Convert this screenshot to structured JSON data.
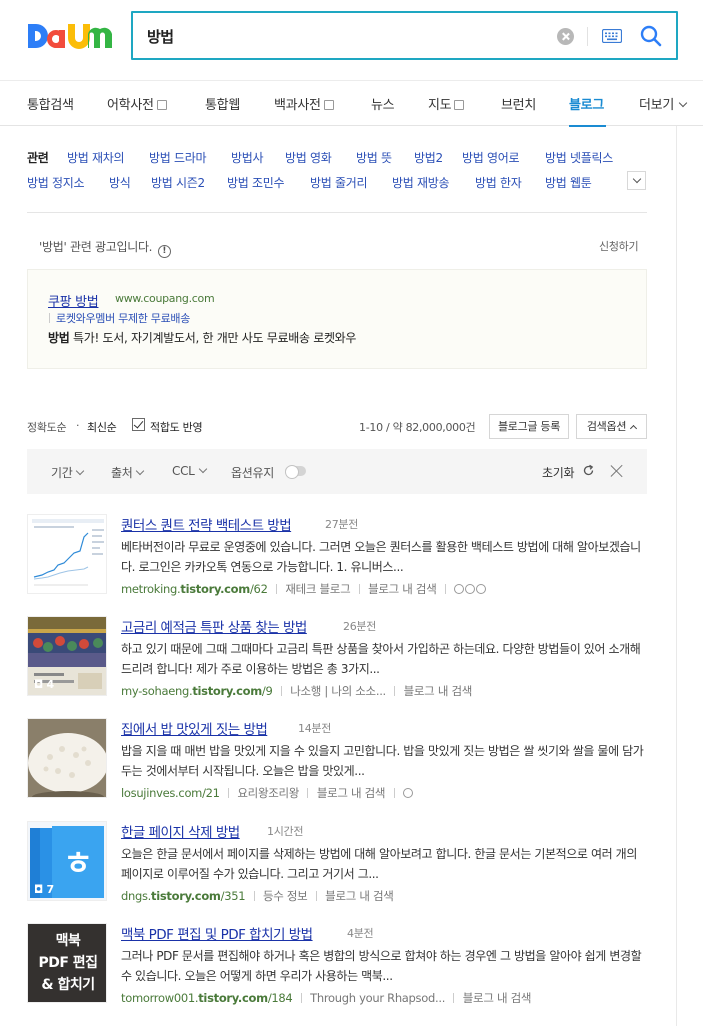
{
  "brand": {
    "logo_text": "Daum",
    "colors": {
      "d": "#2d7ef7",
      "a": "#f24c3d",
      "u": "#fbbd08",
      "m": "#34b544",
      "accent": "#1a8bd2",
      "link": "#1a32a8",
      "url": "#4a7a3a"
    }
  },
  "search": {
    "query": "방법",
    "clear_icon": "clear-icon",
    "keyboard_icon": "keyboard-icon",
    "search_icon": "search-icon"
  },
  "tabs": [
    {
      "label": "통합검색"
    },
    {
      "label": "어학사전"
    },
    {
      "label": "통합웹"
    },
    {
      "label": "백과사전"
    },
    {
      "label": "뉴스"
    },
    {
      "label": "지도"
    },
    {
      "label": "브런치"
    },
    {
      "label": "블로그",
      "active": true
    },
    {
      "label": "더보기"
    }
  ],
  "related": {
    "heading": "관련",
    "links": [
      "방법 재차의",
      "방법 드라마",
      "방법사",
      "방법 영화",
      "방법 뜻",
      "방법2",
      "방법 영어로",
      "방법 넷플릭스",
      "방법 정지소",
      "방식",
      "방법 시즌2",
      "방법 조민수",
      "방법 줄거리",
      "방법 재방송",
      "방법 한자",
      "방법 웹툰"
    ]
  },
  "ad": {
    "notice": "'방법' 관련 광고입니다.",
    "info_icon": "!",
    "apply": "신청하기",
    "title": "쿠팡 방법",
    "url": "www.coupang.com",
    "sub": "로켓와우멤버 무제한 무료배송",
    "desc_bold": "방법",
    "desc_rest": " 특가! 도서, 자기계발도서, 한 개만 사도 무료배송 로켓와우"
  },
  "sort": {
    "accuracy": "정확도순",
    "dot": "·",
    "latest": "최신순",
    "reflect": "적합도 반영",
    "count": "1-10 / 약 82,000,000건",
    "register": "블로그글 등록",
    "options": "검색옵션"
  },
  "filters": {
    "period": "기간",
    "source": "출처",
    "ccl": "CCL",
    "keep": "옵션유지",
    "reset": "초기화"
  },
  "results": [
    {
      "title": "퀀터스 퀀트 전략 백테스트 방법",
      "time": "27분전",
      "desc": "베타버전이라 무료로 운영중에 있습니다. 그러면 오늘은 퀀터스를 활용한 백테스트 방법에 대해 알아보겠습니다. 로그인은 카카오톡 연동으로 가능합니다. 1. 유니버스...",
      "url_pre": "metroking.",
      "url_bold": "tistory.com",
      "url_post": "/62",
      "blog": "재테크 블로그",
      "more": "블로그 내 검색",
      "photo_count": ""
    },
    {
      "title": "고금리 예적금 특판 상품 찾는 방법",
      "time": "26분전",
      "desc": "하고 있기 때문에 그때 그때마다 고금리 특판 상품을 찾아서 가입하곤 하는데요. 다양한 방법들이 있어 소개해드리려 합니다! 제가 주로 이용하는 방법은 총 3가지...",
      "url_pre": "my-sohaeng.",
      "url_bold": "tistory.com",
      "url_post": "/9",
      "blog": "나소행 | 나의 소소...",
      "more": "블로그 내 검색",
      "photo_count": "4"
    },
    {
      "title": "집에서 밥 맛있게 짓는 방법",
      "time": "14분전",
      "desc": "밥을 지을 때 매번 밥을 맛있게 지을 수 있을지 고민합니다. 밥을 맛있게 짓는 방법은 쌀 씻기와 쌀을 물에 담가 두는 것에서부터 시작됩니다. 오늘은 밥을 맛있게...",
      "url_pre": "losujinves.com/21",
      "url_bold": "",
      "url_post": "",
      "blog": "요리왕조리왕",
      "more": "블로그 내 검색",
      "photo_count": ""
    },
    {
      "title": "한글 페이지 삭제 방법",
      "time": "1시간전",
      "desc": "오늘은 한글 문서에서 페이지를 삭제하는 방법에 대해 알아보려고 합니다. 한글 문서는 기본적으로 여러 개의 페이지로 이루어질 수가 있습니다. 그리고 거기서 그...",
      "url_pre": "dngs.",
      "url_bold": "tistory.com",
      "url_post": "/351",
      "blog": "등수 정보",
      "more": "블로그 내 검색",
      "photo_count": "7"
    },
    {
      "title": "맥북 PDF 편집 및 PDF 합치기 방법",
      "time": "4분전",
      "desc": "그러나 PDF 문서를 편집해야 하거나 혹은 병합의 방식으로 합쳐야 하는 경우엔 그 방법을 알아야 쉽게 변경할 수 있습니다. 오늘은 어떻게 하면 우리가 사용하는 맥북...",
      "url_pre": "tomorrow001.",
      "url_bold": "tistory.com",
      "url_post": "/184",
      "blog": "Through your Rhapsod...",
      "more": "블로그 내 검색",
      "photo_count": "",
      "thumb_text": [
        "맥북",
        "PDF 편집",
        "& 합치기"
      ]
    }
  ]
}
